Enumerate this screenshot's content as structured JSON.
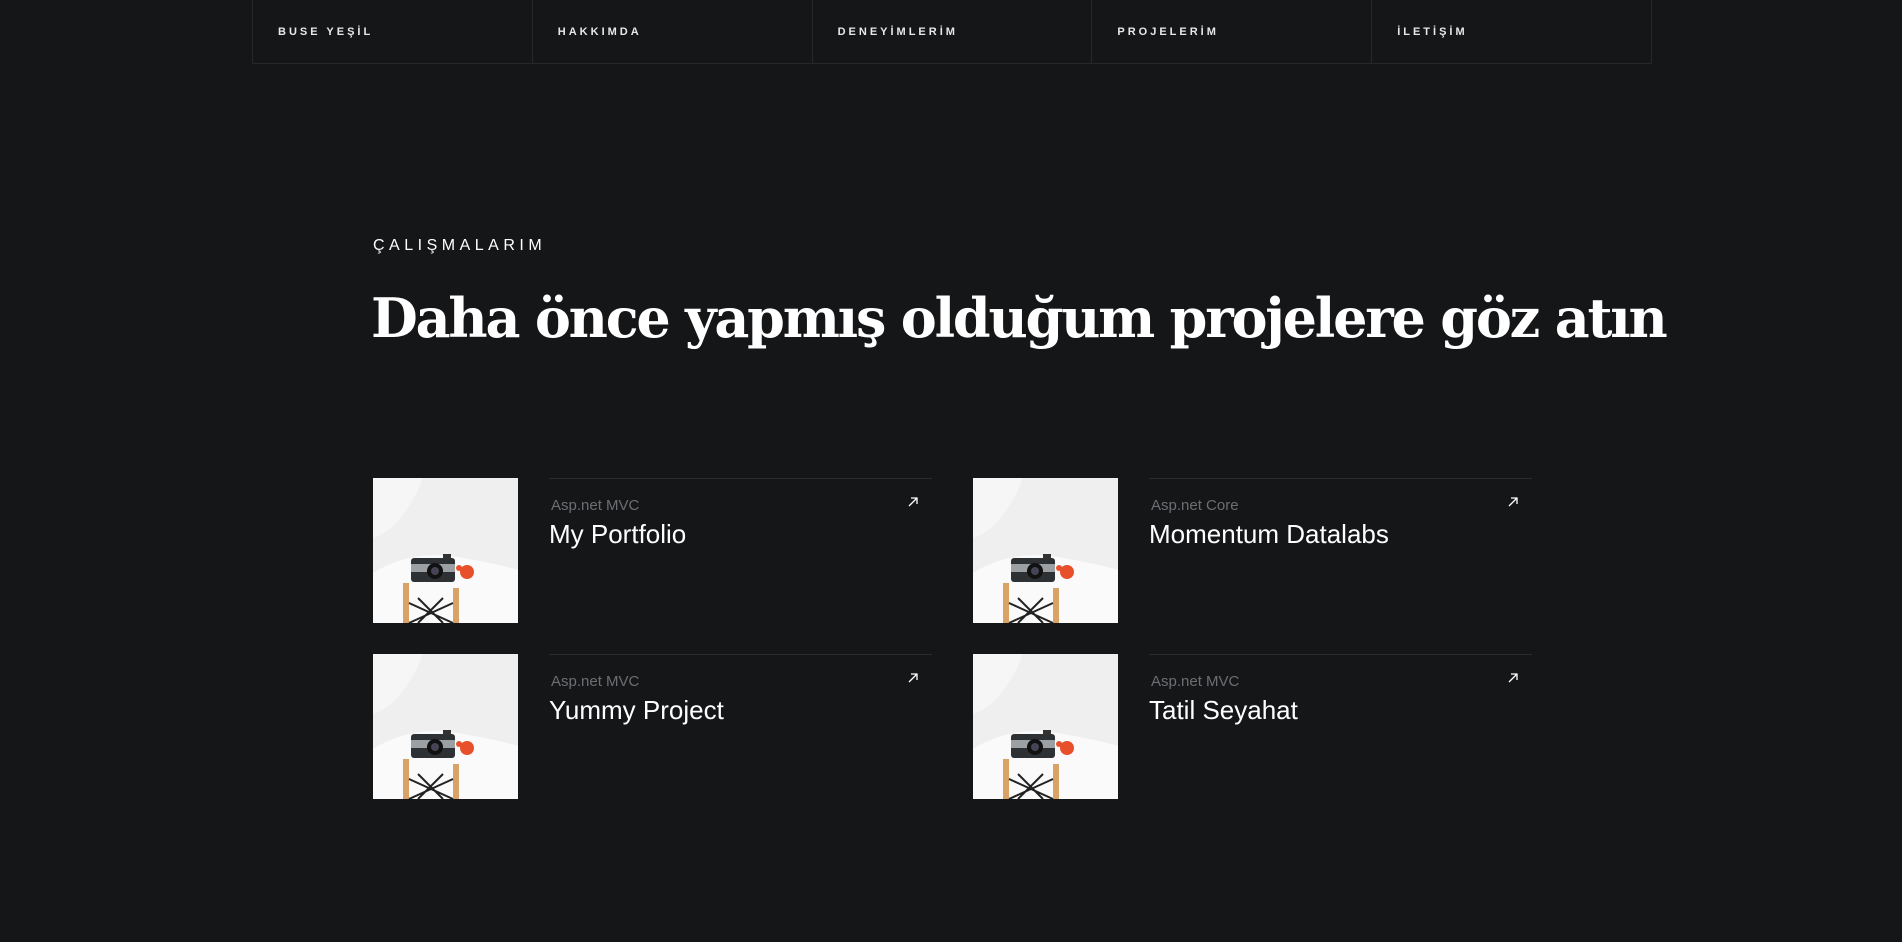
{
  "nav": {
    "items": [
      {
        "label": "BUSE YEŞİL"
      },
      {
        "label": "HAKKIMDA"
      },
      {
        "label": "DENEYİMLERİM"
      },
      {
        "label": "PROJELERİM"
      },
      {
        "label": "İLETİŞİM"
      }
    ]
  },
  "section": {
    "eyebrow": "ÇALIŞMALARIM",
    "headline": "Daha önce yapmış olduğum projelere göz atın"
  },
  "projects": [
    {
      "tech": "Asp.net MVC",
      "title": "My Portfolio"
    },
    {
      "tech": "Asp.net Core",
      "title": "Momentum Datalabs"
    },
    {
      "tech": "Asp.net MVC",
      "title": "Yummy Project"
    },
    {
      "tech": "Asp.net MVC",
      "title": "Tatil Seyahat"
    }
  ],
  "icons": {
    "arrow": "arrow-up-right-icon",
    "thumbnail": "camera-on-chair-image"
  },
  "colors": {
    "background": "#151618",
    "text": "#ffffff",
    "muted": "#6c6e72",
    "divider": "#26282b"
  }
}
